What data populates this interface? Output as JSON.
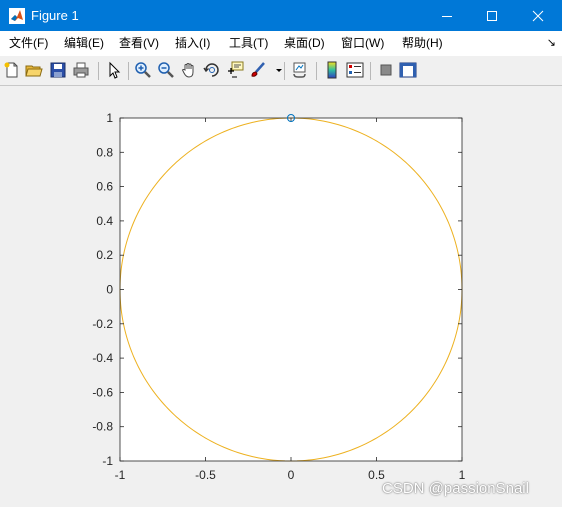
{
  "window": {
    "title": "Figure 1"
  },
  "menu": [
    {
      "label": "文件(F)"
    },
    {
      "label": "编辑(E)"
    },
    {
      "label": "查看(V)"
    },
    {
      "label": "插入(I)"
    },
    {
      "label": "工具(T)"
    },
    {
      "label": "桌面(D)"
    },
    {
      "label": "窗口(W)"
    },
    {
      "label": "帮助(H)"
    }
  ],
  "toolbar": {
    "icons": [
      "new-figure-icon",
      "open-file-icon",
      "save-icon",
      "print-icon",
      "select-arrow-icon",
      "zoom-in-icon",
      "zoom-out-icon",
      "pan-hand-icon",
      "rotate-3d-icon",
      "data-cursor-icon",
      "brush-icon",
      "brush-dropdown-icon",
      "link-plot-icon",
      "colorbar-icon",
      "legend-icon",
      "hide-plot-tools-icon",
      "show-plot-tools-icon"
    ]
  },
  "chart_data": {
    "type": "line",
    "title": "",
    "xlabel": "",
    "ylabel": "",
    "xlim": [
      -1,
      1
    ],
    "ylim": [
      -1,
      1
    ],
    "xticks": [
      -1,
      -0.5,
      0,
      0.5,
      1
    ],
    "yticks": [
      -1,
      -0.8,
      -0.6,
      -0.4,
      -0.2,
      0,
      0.2,
      0.4,
      0.6,
      0.8,
      1
    ],
    "grid": false,
    "series": [
      {
        "kind": "line",
        "shape": "unit circle x=cos(t), y=sin(t)",
        "color": "#edb120"
      },
      {
        "kind": "marker",
        "marker": "o",
        "x": [
          0
        ],
        "y": [
          1
        ],
        "color": "#0072bd"
      }
    ]
  },
  "watermark": "CSDN @passionSnail",
  "colors": {
    "titlebar": "#0078d7",
    "circle": "#edb120",
    "marker": "#0072bd"
  }
}
